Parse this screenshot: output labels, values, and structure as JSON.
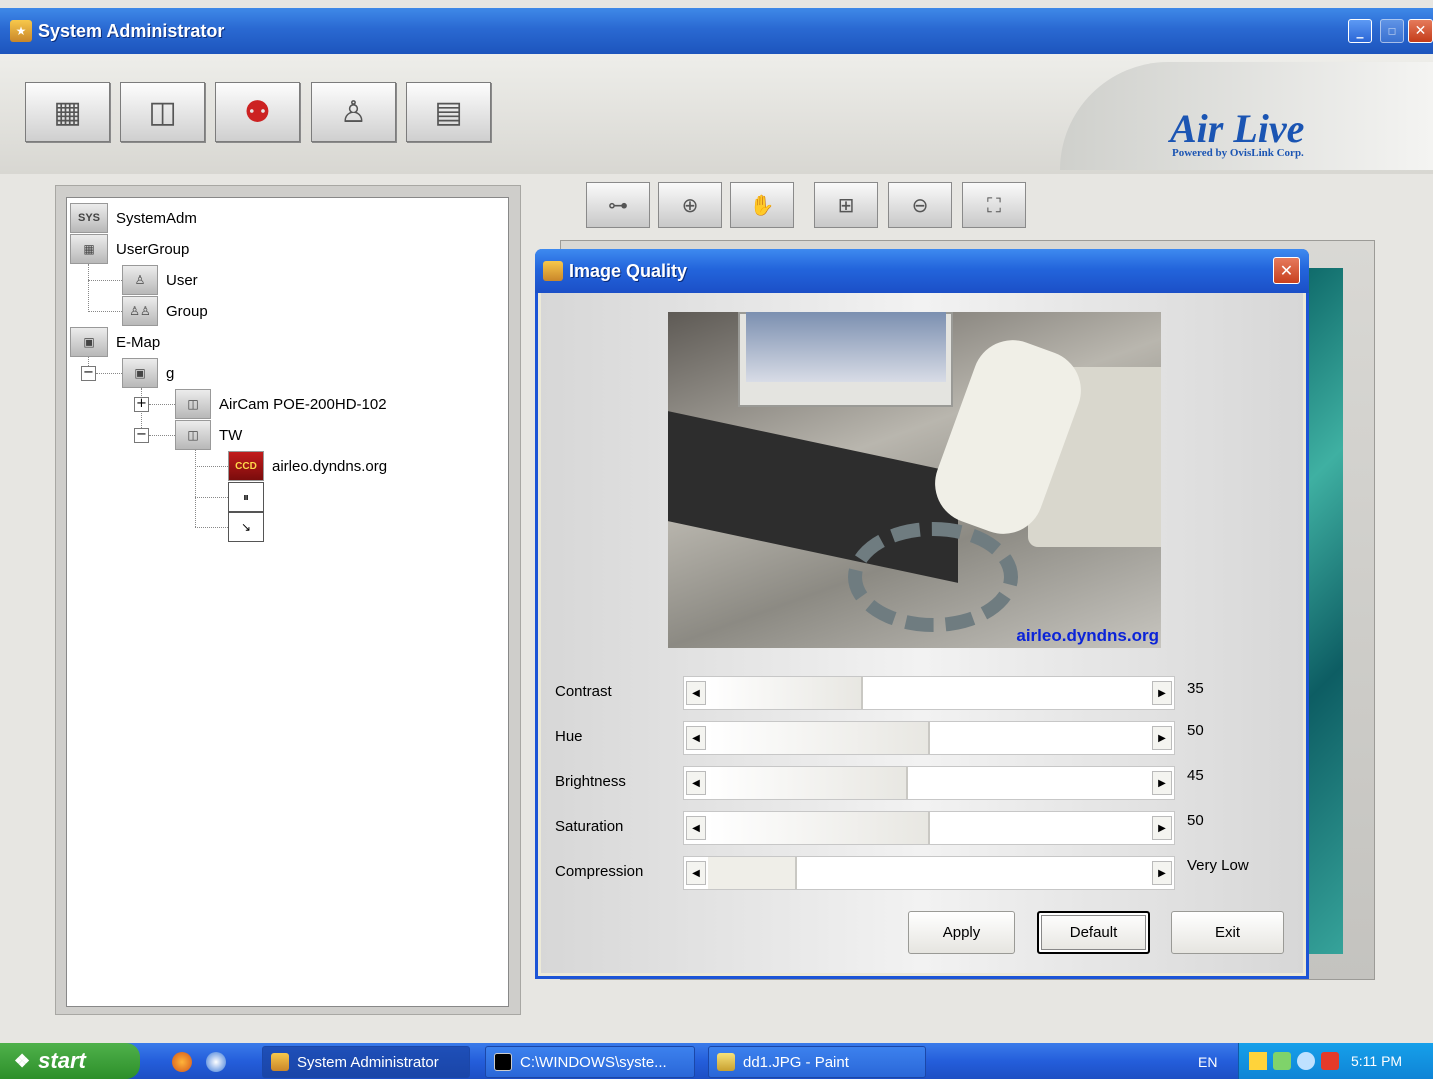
{
  "window": {
    "title": "System Administrator"
  },
  "toolbar": {
    "icons": [
      "video-wall-icon",
      "camera-icon",
      "group-alarm-icon",
      "user-group-icon",
      "layout-icon"
    ]
  },
  "logo": {
    "brand": "Air Live",
    "tagline": "Powered by OvisLink Corp."
  },
  "tree": {
    "root": "SystemAdm",
    "usergroup": "UserGroup",
    "user": "User",
    "group": "Group",
    "emap": "E-Map",
    "map_g": "g",
    "camera1": "AirCam POE-200HD-102",
    "camera2": "TW",
    "stream": "airleo.dyndns.org"
  },
  "viewer_toolbar": {
    "icons": [
      "connect-icon",
      "zoom-in-icon",
      "hand-icon",
      "zoom-fit-icon",
      "zoom-out-icon",
      "fullscreen-icon"
    ]
  },
  "dialog": {
    "title": "Image Quality",
    "video_overlay": "airleo.dyndns.org",
    "sliders": [
      {
        "label": "Contrast",
        "value": "35",
        "level": 0.35
      },
      {
        "label": "Hue",
        "value": "50",
        "level": 0.5
      },
      {
        "label": "Brightness",
        "value": "45",
        "level": 0.45
      },
      {
        "label": "Saturation",
        "value": "50",
        "level": 0.5
      },
      {
        "label": "Compression",
        "value": "Very Low",
        "level": 0.2
      }
    ],
    "buttons": {
      "apply": "Apply",
      "default": "Default",
      "exit": "Exit"
    }
  },
  "taskbar": {
    "start": "start",
    "tasks": [
      "System Administrator",
      "C:\\WINDOWS\\syste...",
      "dd1.JPG - Paint"
    ],
    "lang": "EN",
    "clock": "5:11 PM"
  }
}
